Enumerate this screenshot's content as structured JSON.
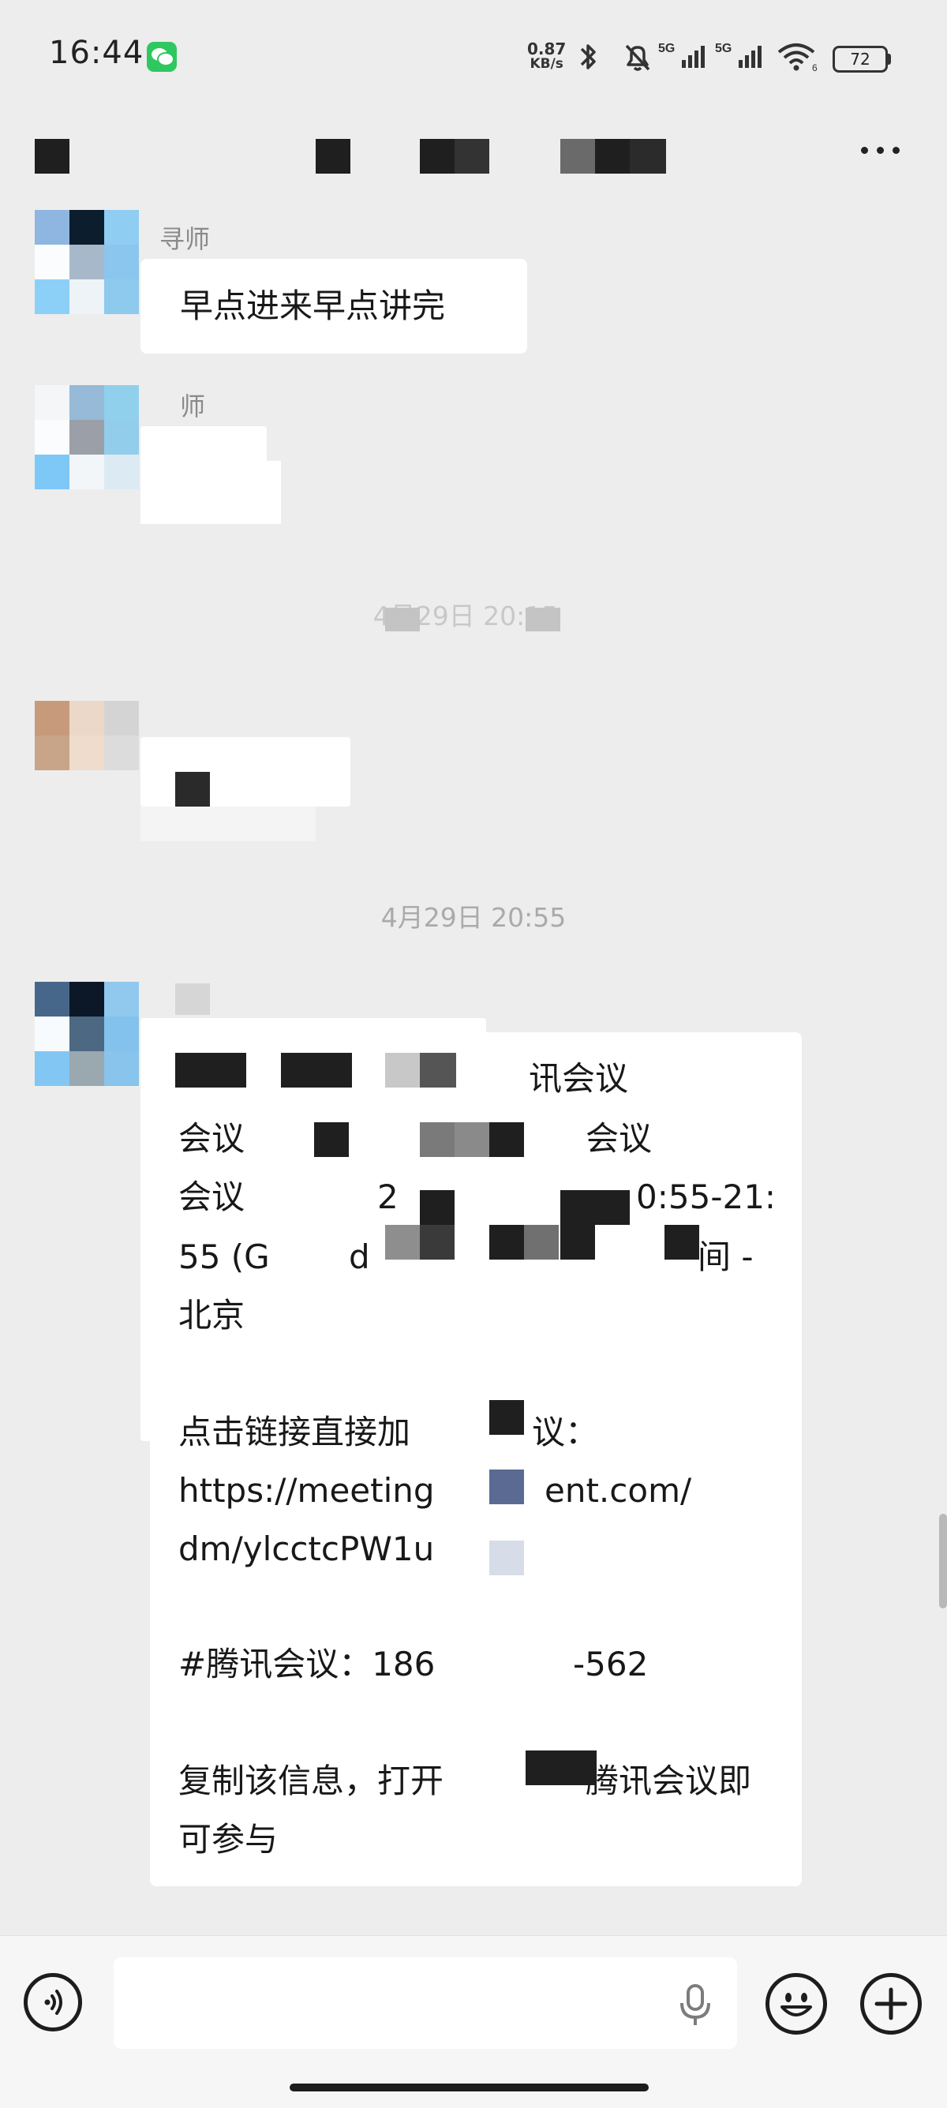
{
  "status_bar": {
    "time": "16:44",
    "net_speed_value": "0.87",
    "net_speed_unit": "KB/s",
    "battery": "72",
    "signal_labels": [
      "5G",
      "5G"
    ],
    "icons": [
      "wechat-notification-icon",
      "bluetooth-icon",
      "mute-icon",
      "signal-icon",
      "signal-icon",
      "wifi-icon",
      "battery-icon"
    ]
  },
  "header": {
    "more_label": "···"
  },
  "messages": [
    {
      "sender": "寻师",
      "text": "早点进来早点讲完"
    },
    {
      "sender": "师",
      "text": ""
    },
    {
      "timestamp": "4月29日 20:15"
    },
    {
      "text": ""
    },
    {
      "timestamp": "4月29日 20:55"
    },
    {
      "lines": [
        "讯会议",
        "会议",
        "会议",
        "会议",
        "2",
        "0:55-21:",
        "55 (G",
        "d",
        "间 -",
        "北京",
        "点击链接直接加",
        "议：",
        "https://meeting",
        "ent.com/",
        "dm/ylcctcPW1u",
        "#腾讯会议：186",
        "-562",
        "复制该信息，打开",
        "腾讯会议即",
        "可参与"
      ]
    }
  ],
  "input_bar": {
    "voice_icon": "voice-mode-icon",
    "mic_icon": "microphone-icon",
    "emoji_icon": "emoji-icon",
    "plus_icon": "plus-icon"
  },
  "colors": {
    "background": "#ededed",
    "bubble": "#ffffff",
    "link": "#576b95",
    "wechat_green": "#2fc760"
  }
}
